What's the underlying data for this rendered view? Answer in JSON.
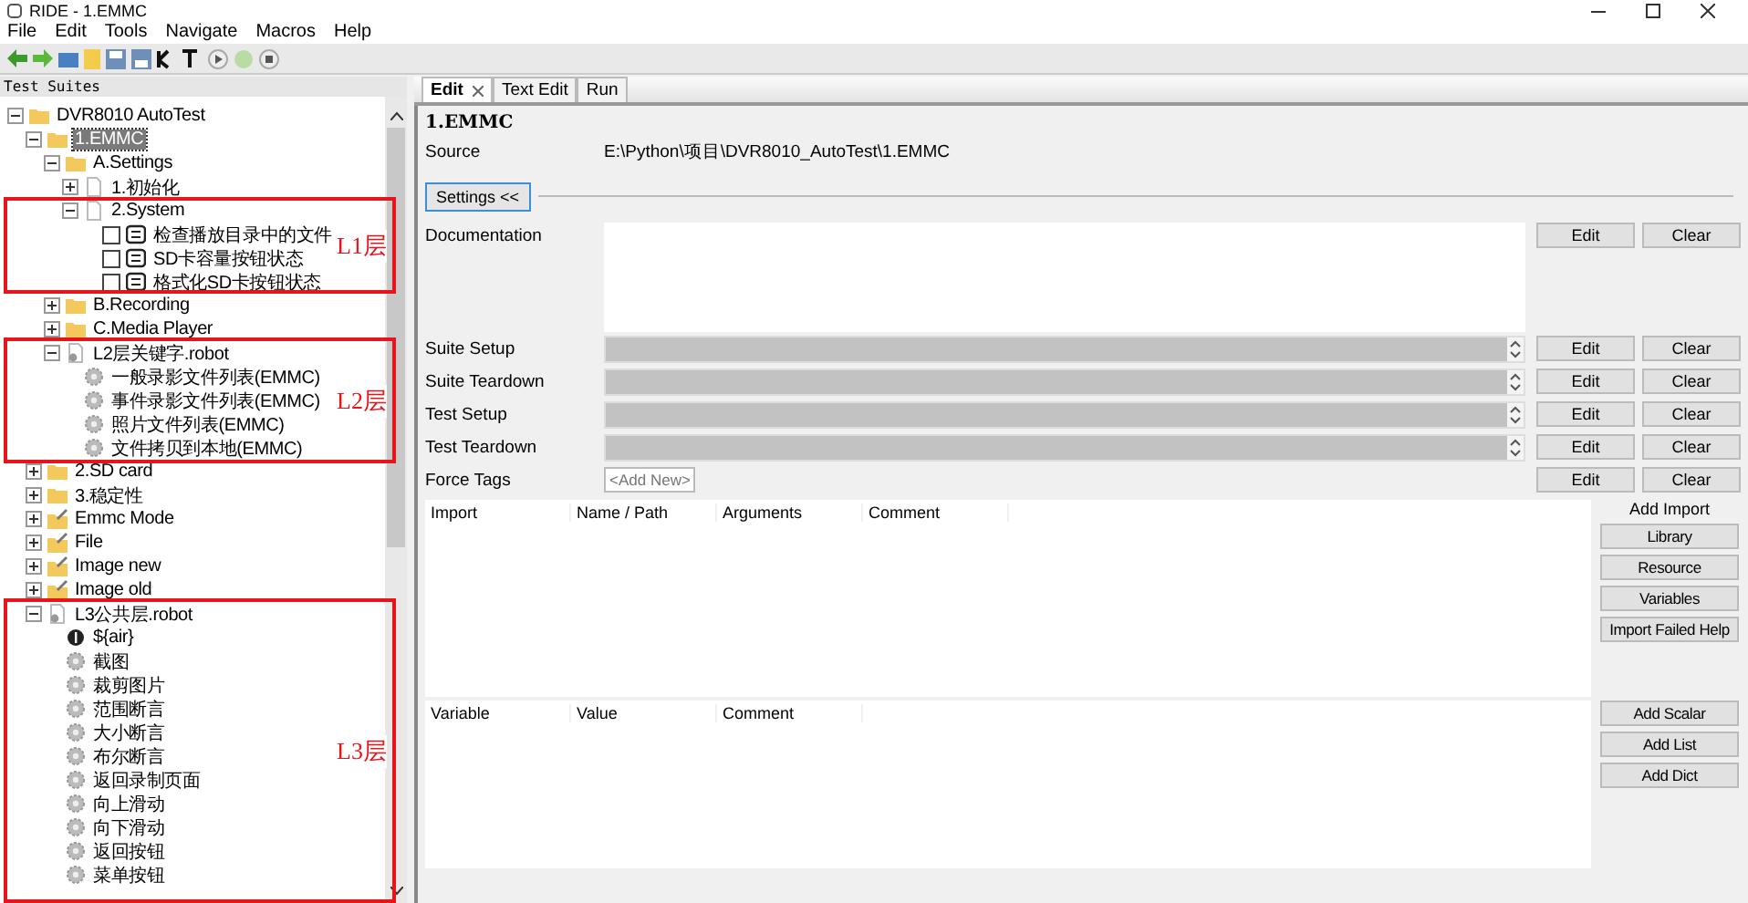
{
  "window": {
    "title": "RIDE - 1.EMMC"
  },
  "menu": [
    "File",
    "Edit",
    "Tools",
    "Navigate",
    "Macros",
    "Help"
  ],
  "tree_panel": {
    "title": "Test Suites",
    "items": [
      {
        "label": "DVR8010 AutoTest",
        "kind": "folder",
        "expanded": true,
        "selected": false,
        "children": [
          {
            "label": "1.EMMC",
            "kind": "folder",
            "expanded": true,
            "selected": true,
            "children": [
              {
                "label": "A.Settings",
                "kind": "folder",
                "expanded": true,
                "selected": false,
                "children": [
                  {
                    "label": "1.初始化",
                    "kind": "file",
                    "expanded": false,
                    "selected": false
                  },
                  {
                    "label": "2.System",
                    "kind": "file",
                    "expanded": true,
                    "selected": false,
                    "children": [
                      {
                        "label": "检查播放目录中的文件",
                        "kind": "test",
                        "checked": false,
                        "selected": false
                      },
                      {
                        "label": "SD卡容量按钮状态",
                        "kind": "test",
                        "checked": false,
                        "selected": false
                      },
                      {
                        "label": "格式化SD卡按钮状态",
                        "kind": "test",
                        "checked": false,
                        "selected": false
                      }
                    ]
                  }
                ]
              },
              {
                "label": "B.Recording",
                "kind": "folder",
                "expanded": false,
                "selected": false
              },
              {
                "label": "C.Media Player",
                "kind": "folder",
                "expanded": false,
                "selected": false
              },
              {
                "label": "L2层关键字.robot",
                "kind": "resource",
                "expanded": true,
                "selected": false,
                "children": [
                  {
                    "label": "一般录影文件列表(EMMC)",
                    "kind": "keyword",
                    "selected": false
                  },
                  {
                    "label": "事件录影文件列表(EMMC)",
                    "kind": "keyword",
                    "selected": false
                  },
                  {
                    "label": "照片文件列表(EMMC)",
                    "kind": "keyword",
                    "selected": false
                  },
                  {
                    "label": "文件拷贝到本地(EMMC)",
                    "kind": "keyword",
                    "selected": false
                  }
                ]
              }
            ]
          },
          {
            "label": "2.SD card",
            "kind": "folder",
            "expanded": false,
            "selected": false
          },
          {
            "label": "3.稳定性",
            "kind": "folder",
            "expanded": false,
            "selected": false
          },
          {
            "label": "Emmc Mode",
            "kind": "edited",
            "expanded": false,
            "selected": false
          },
          {
            "label": "File",
            "kind": "edited",
            "expanded": false,
            "selected": false
          },
          {
            "label": "Image new",
            "kind": "edited",
            "expanded": false,
            "selected": false
          },
          {
            "label": "Image old",
            "kind": "edited",
            "expanded": false,
            "selected": false
          },
          {
            "label": "L3公共层.robot",
            "kind": "resource",
            "expanded": true,
            "selected": false,
            "children": [
              {
                "label": "${air}",
                "kind": "variable",
                "selected": false
              },
              {
                "label": "截图",
                "kind": "keyword",
                "selected": false
              },
              {
                "label": "裁剪图片",
                "kind": "keyword",
                "selected": false
              },
              {
                "label": "范围断言",
                "kind": "keyword",
                "selected": false
              },
              {
                "label": "大小断言",
                "kind": "keyword",
                "selected": false
              },
              {
                "label": "布尔断言",
                "kind": "keyword",
                "selected": false
              },
              {
                "label": "返回录制页面",
                "kind": "keyword",
                "selected": false
              },
              {
                "label": "向上滑动",
                "kind": "keyword",
                "selected": false
              },
              {
                "label": "向下滑动",
                "kind": "keyword",
                "selected": false
              },
              {
                "label": "返回按钮",
                "kind": "keyword",
                "selected": false
              },
              {
                "label": "菜单按钮",
                "kind": "keyword",
                "selected": false
              }
            ]
          }
        ]
      }
    ]
  },
  "annotations": [
    {
      "label": "L1层"
    },
    {
      "label": "L2层"
    },
    {
      "label": "L3层"
    }
  ],
  "tabs": [
    {
      "label": "Edit",
      "selected": true,
      "closable": true
    },
    {
      "label": "Text Edit",
      "selected": false,
      "closable": false
    },
    {
      "label": "Run",
      "selected": false,
      "closable": false
    }
  ],
  "editor": {
    "name": "1.EMMC",
    "source_label": "Source",
    "source": "E:\\Python\\项目\\DVR8010_AutoTest\\1.EMMC",
    "settings_button": "Settings <<",
    "settings": [
      {
        "label": "Documentation",
        "kind": "text",
        "buttons": [
          "Edit",
          "Clear"
        ]
      },
      {
        "label": "Suite Setup",
        "kind": "combo",
        "buttons": [
          "Edit",
          "Clear"
        ]
      },
      {
        "label": "Suite Teardown",
        "kind": "combo",
        "buttons": [
          "Edit",
          "Clear"
        ]
      },
      {
        "label": "Test Setup",
        "kind": "combo",
        "buttons": [
          "Edit",
          "Clear"
        ]
      },
      {
        "label": "Test Teardown",
        "kind": "combo",
        "buttons": [
          "Edit",
          "Clear"
        ]
      },
      {
        "label": "Force Tags",
        "kind": "tags",
        "placeholder": "<Add New>",
        "buttons": [
          "Edit",
          "Clear"
        ]
      }
    ],
    "import_table": {
      "columns": [
        "Import",
        "Name / Path",
        "Arguments",
        "Comment"
      ],
      "buttons_title": "Add Import",
      "buttons": [
        "Library",
        "Resource",
        "Variables",
        "Import Failed Help"
      ]
    },
    "variable_table": {
      "columns": [
        "Variable",
        "Value",
        "Comment"
      ],
      "buttons": [
        "Add Scalar",
        "Add List",
        "Add Dict"
      ]
    }
  }
}
